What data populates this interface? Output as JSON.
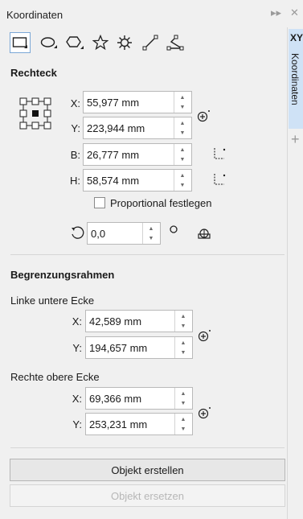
{
  "window": {
    "title": "Koordinaten",
    "collapse_glyph": "▸▸",
    "close_glyph": "✕"
  },
  "side_tab": {
    "xy": "XY",
    "label": "Koordinaten",
    "add_glyph": "+"
  },
  "toolbar": {
    "tools": [
      "rectangle-tool",
      "ellipse-tool",
      "polygon-tool",
      "star-tool",
      "complex-star-tool",
      "line-tool",
      "polyline-tool"
    ]
  },
  "rect": {
    "title": "Rechteck",
    "x_label": "X:",
    "x_value": "55,977 mm",
    "y_label": "Y:",
    "y_value": "223,944 mm",
    "w_label": "B:",
    "w_value": "26,777 mm",
    "h_label": "H:",
    "h_value": "58,574 mm",
    "proportional_label": "Proportional festlegen",
    "rotation_value": "0,0"
  },
  "bbox": {
    "title": "Begrenzungsrahmen",
    "lower_left_title": "Linke untere Ecke",
    "ll_x_label": "X:",
    "ll_x_value": "42,589 mm",
    "ll_y_label": "Y:",
    "ll_y_value": "194,657 mm",
    "upper_right_title": "Rechte obere Ecke",
    "ur_x_label": "X:",
    "ur_x_value": "69,366 mm",
    "ur_y_label": "Y:",
    "ur_y_value": "253,231 mm"
  },
  "actions": {
    "create_label": "Objekt erstellen",
    "replace_label": "Objekt ersetzen"
  },
  "colors": {
    "accent": "#cfe2f6",
    "active_border": "#7aa7d6",
    "disabled_text": "#b7b7b7"
  }
}
